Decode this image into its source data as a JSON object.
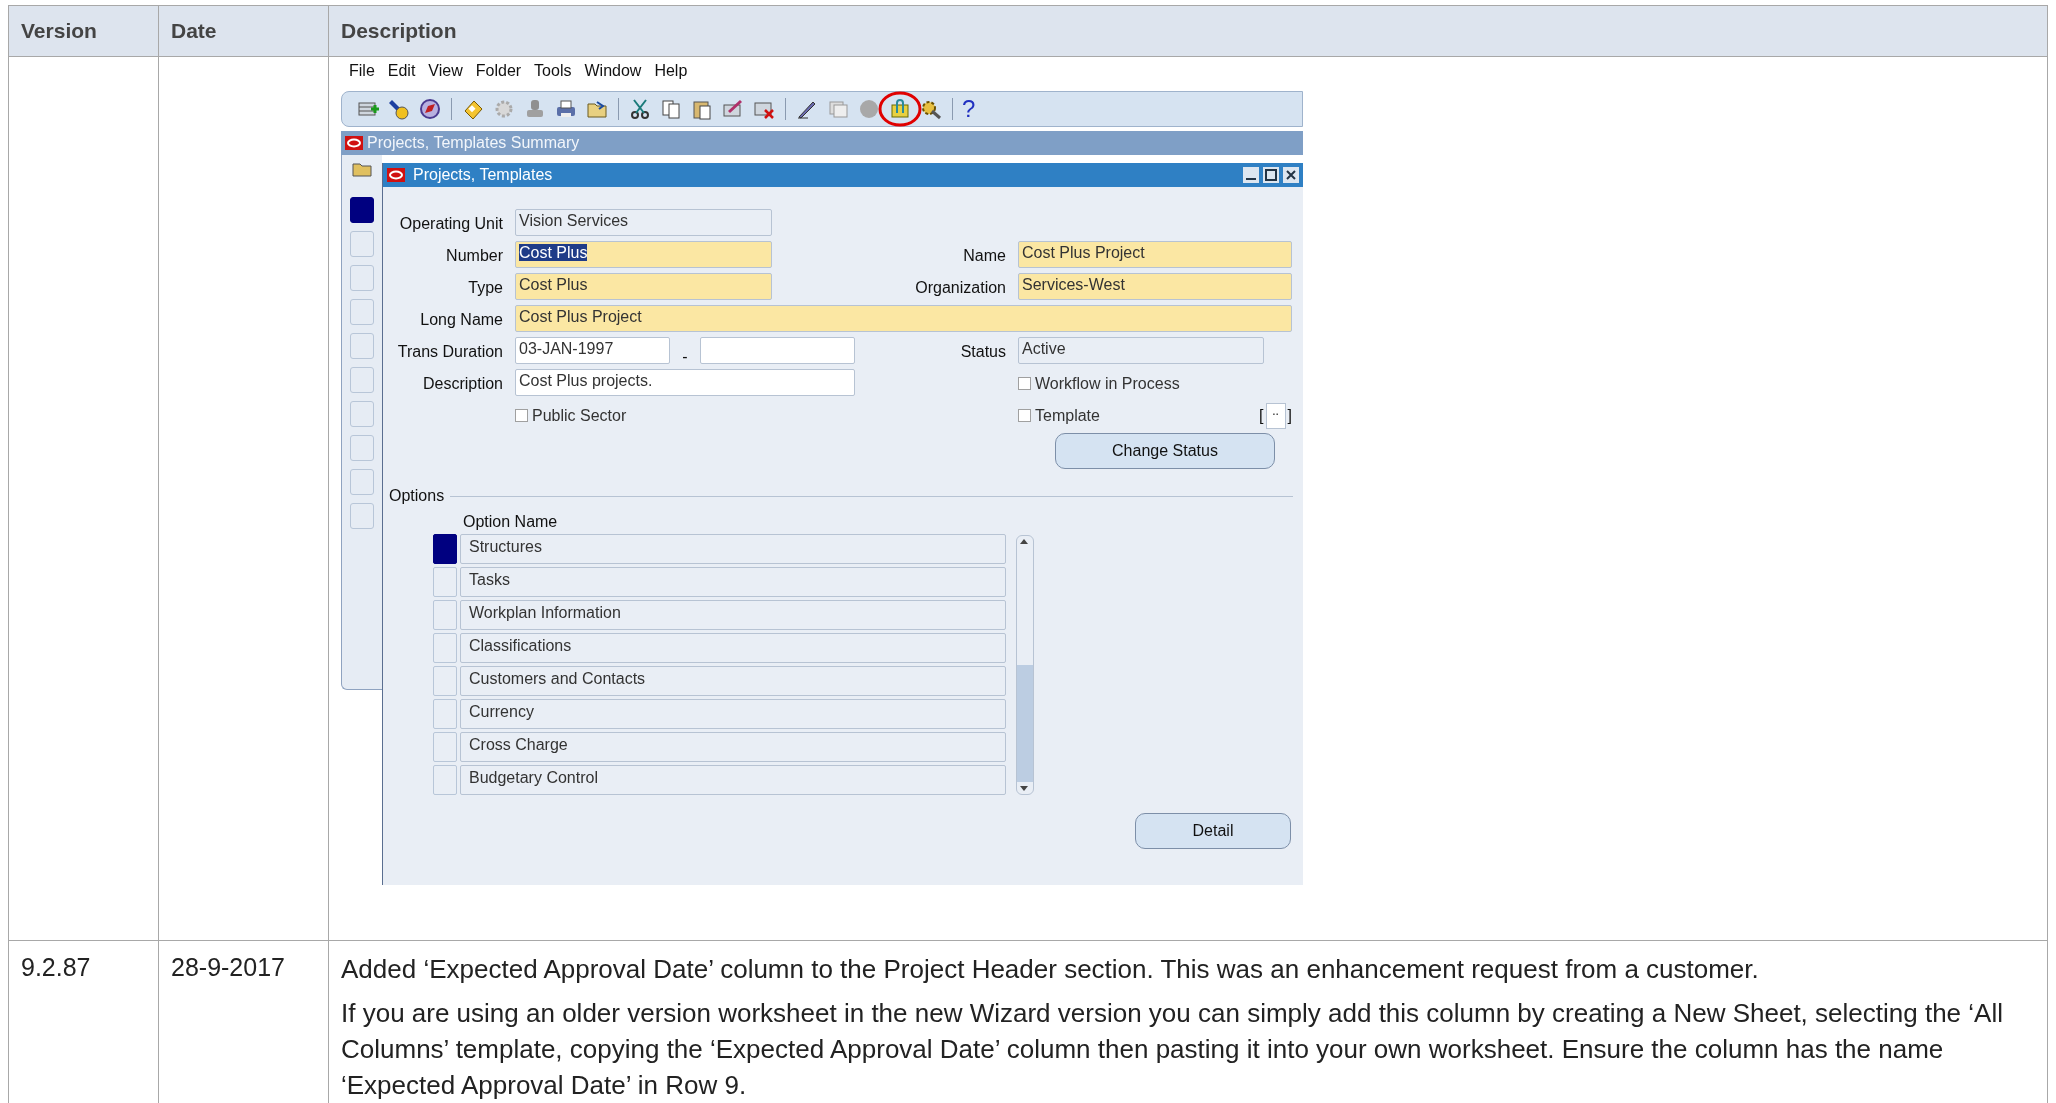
{
  "table": {
    "columns": [
      "Version",
      "Date",
      "Description"
    ],
    "rows": [
      {
        "kind": "screenshot",
        "version": "",
        "date": "",
        "screen": {
          "menu": [
            "File",
            "Edit",
            "View",
            "Folder",
            "Tools",
            "Window",
            "Help"
          ],
          "help_glyph": "?",
          "summary_title": "Projects, Templates Summary",
          "window_title": "Projects, Templates",
          "fields_left": [
            {
              "label": "Operating Unit",
              "value": "Vision Services",
              "kind": "readonly"
            },
            {
              "label": "Number",
              "value": "Cost Plus",
              "kind": "required"
            },
            {
              "label": "Type",
              "value": "Cost Plus",
              "kind": "required"
            }
          ],
          "fields_right": [
            {
              "label": "Name",
              "value": "Cost Plus Project",
              "kind": "required"
            },
            {
              "label": "Organization",
              "value": "Services-West",
              "kind": "required"
            }
          ],
          "long_name": {
            "label": "Long Name",
            "value": "Cost Plus Project"
          },
          "trans_duration": {
            "label": "Trans Duration",
            "from": "03-JAN-1997",
            "separator": "-"
          },
          "status": {
            "label": "Status",
            "value": "Active"
          },
          "description": {
            "label": "Description",
            "value": "Cost Plus projects."
          },
          "checkboxes": [
            {
              "label": "Workflow in Process",
              "checked": false
            },
            {
              "label": "Public Sector",
              "checked": false
            },
            {
              "label": "Template",
              "checked": false
            }
          ],
          "bracket_open": "[",
          "bracket_dots": "..",
          "bracket_close": "]",
          "change_status": "Change Status",
          "options": {
            "title": "Options",
            "column": "Option Name",
            "rows": [
              {
                "name": "Structures",
                "selected": true
              },
              {
                "name": "Tasks",
                "selected": false
              },
              {
                "name": "Workplan Information",
                "selected": false
              },
              {
                "name": "Classifications",
                "selected": false
              },
              {
                "name": "Customers and Contacts",
                "selected": false
              },
              {
                "name": "Currency",
                "selected": false
              },
              {
                "name": "Cross Charge",
                "selected": false
              },
              {
                "name": "Budgetary Control",
                "selected": false
              }
            ]
          },
          "detail": "Detail"
        }
      },
      {
        "kind": "text",
        "version": "9.2.87",
        "date": "28-9-2017",
        "paragraphs": [
          "Added ‘Expected Approval Date’ column to the Project Header section.  This was an enhancement request from a customer.",
          "If you are using an older version worksheet in the new Wizard version you can simply add this column by creating a New Sheet, selecting the ‘All Columns’ template, copying the ‘Expected Approval Date’ column then pasting it into your own worksheet.  Ensure the column has the name ‘Expected Approval Date’ in Row 9."
        ]
      }
    ]
  }
}
